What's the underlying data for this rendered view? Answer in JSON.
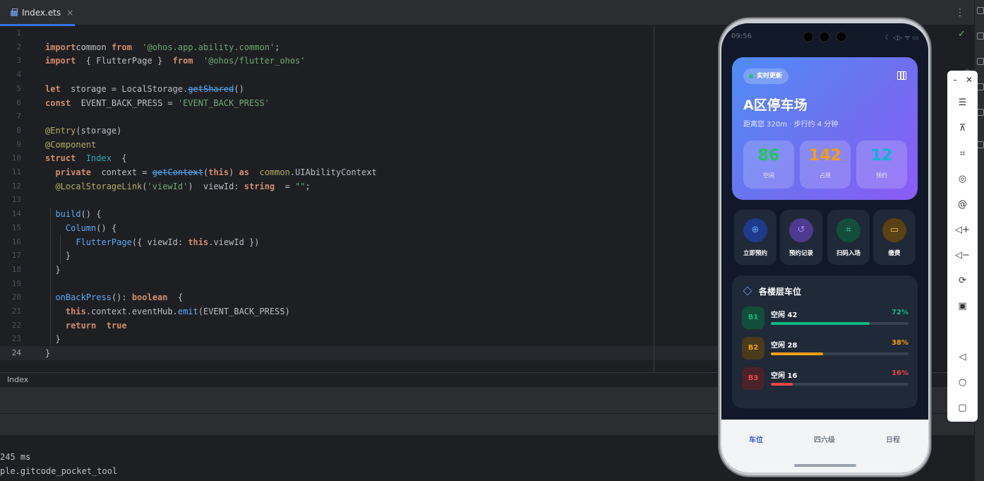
{
  "editor_tab": {
    "filename": "Index.ets",
    "close": "×"
  },
  "toolbar": {
    "more": "⋮",
    "check": "✓"
  },
  "code": {
    "line_numbers": [
      "1",
      "2",
      "3",
      "4",
      "5",
      "6",
      "7",
      "8",
      "9",
      "10",
      "11",
      "12",
      "13",
      "14",
      "15",
      "16",
      "17",
      "18",
      "19",
      "20",
      "21",
      "22",
      "23",
      "24"
    ],
    "lines": [
      [],
      [
        [
          "kw",
          "import"
        ],
        [
          "",
          "common "
        ],
        [
          "kw",
          "from"
        ],
        [
          "",
          "  "
        ],
        [
          "str",
          "'@ohos.app.ability.common'"
        ],
        [
          "",
          ";"
        ]
      ],
      [
        [
          "kw",
          "import"
        ],
        [
          "",
          "  { FlutterPage }  "
        ],
        [
          "kw",
          "from"
        ],
        [
          "",
          "  "
        ],
        [
          "str",
          "'@ohos/flutter_ohos'"
        ]
      ],
      [],
      [
        [
          "kw",
          "let"
        ],
        [
          "",
          "  storage = LocalStorage."
        ],
        [
          "st",
          "getShared"
        ],
        [
          "",
          "()"
        ]
      ],
      [
        [
          "kw",
          "const"
        ],
        [
          "",
          "  EVENT_BACK_PRESS = "
        ],
        [
          "str",
          "'EVENT_BACK_PRESS'"
        ]
      ],
      [],
      [
        [
          "ann",
          "@Entry"
        ],
        [
          "",
          "(storage)"
        ]
      ],
      [
        [
          "ann",
          "@Component"
        ]
      ],
      [
        [
          "kw",
          "struct"
        ],
        [
          "",
          "  "
        ],
        [
          "ty",
          "Index"
        ],
        [
          "",
          "  {"
        ]
      ],
      [
        [
          "",
          "  "
        ],
        [
          "kw",
          "private"
        ],
        [
          "",
          "  context = "
        ],
        [
          "st",
          "getContext"
        ],
        [
          "",
          "("
        ],
        [
          "kw",
          "this"
        ],
        [
          "",
          ") "
        ],
        [
          "kw",
          "as"
        ],
        [
          "",
          "  "
        ],
        [
          "ann",
          "common"
        ],
        [
          "",
          ".UIAbilityContext"
        ]
      ],
      [
        [
          "",
          "  "
        ],
        [
          "ann",
          "@LocalStorageLink"
        ],
        [
          "",
          "("
        ],
        [
          "str",
          "'viewId'"
        ],
        [
          "",
          ")  viewId: "
        ],
        [
          "kw",
          "string"
        ],
        [
          "",
          "  = "
        ],
        [
          "str",
          "\"\""
        ],
        [
          "",
          ";"
        ]
      ],
      [],
      [
        [
          "",
          "  "
        ],
        [
          "fn",
          "build"
        ],
        [
          "",
          "() {"
        ]
      ],
      [
        [
          "",
          "    "
        ],
        [
          "fn",
          "Column"
        ],
        [
          "",
          "() {"
        ]
      ],
      [
        [
          "",
          "      "
        ],
        [
          "fn",
          "FlutterPage"
        ],
        [
          "",
          "({ viewId: "
        ],
        [
          "kw",
          "this"
        ],
        [
          "",
          ".viewId })"
        ]
      ],
      [
        [
          "",
          "    }"
        ]
      ],
      [
        [
          "",
          "  }"
        ]
      ],
      [],
      [
        [
          "",
          "  "
        ],
        [
          "fn",
          "onBackPress"
        ],
        [
          "",
          "(): "
        ],
        [
          "kw",
          "boolean"
        ],
        [
          "",
          "  {"
        ]
      ],
      [
        [
          "",
          "    "
        ],
        [
          "kw",
          "this"
        ],
        [
          "",
          ".context.eventHub."
        ],
        [
          "fn",
          "emit"
        ],
        [
          "",
          "(EVENT_BACK_PRESS)"
        ]
      ],
      [
        [
          "",
          "    "
        ],
        [
          "kw",
          "return"
        ],
        [
          "",
          "  "
        ],
        [
          "kw",
          "true"
        ]
      ],
      [
        [
          "",
          "  }"
        ]
      ],
      [
        [
          "",
          "}"
        ]
      ]
    ]
  },
  "breadcrumb": "Index",
  "console": {
    "line1": "245 ms",
    "line2": "ple.gitcode_pocket_tool"
  },
  "phone": {
    "status_time": "09:56",
    "status_right": "☾ ◁▷ ᯤ ▭",
    "hero": {
      "badge": "实时更新",
      "title": "A区停车场",
      "subtitle": "距离您 320m · 步行约 4 分钟",
      "stats": [
        {
          "value": "86",
          "label": "空闲",
          "color": "#22c55e"
        },
        {
          "value": "142",
          "label": "占用",
          "color": "#f59e0b"
        },
        {
          "value": "12",
          "label": "预约",
          "color": "#06b6d4"
        }
      ]
    },
    "actions": [
      {
        "label": "立即预约",
        "icon": "⊕",
        "bg": "#1e3a8a",
        "fg": "#60a5fa"
      },
      {
        "label": "预约记录",
        "icon": "↺",
        "bg": "#4c3b8f",
        "fg": "#a78bfa"
      },
      {
        "label": "扫码入场",
        "icon": "⌗",
        "bg": "#134e3a",
        "fg": "#34d399"
      },
      {
        "label": "缴费",
        "icon": "▭",
        "bg": "#5a4214",
        "fg": "#fbbf24"
      }
    ],
    "floors": {
      "title": "各楼层车位",
      "rows": [
        {
          "floor": "B1",
          "label": "空闲 42",
          "pct": "72%",
          "fill": 0.72,
          "color": "#10b981",
          "bg": "#134e3a"
        },
        {
          "floor": "B2",
          "label": "空闲 28",
          "pct": "38%",
          "fill": 0.38,
          "color": "#f59e0b",
          "bg": "#4a3b1a"
        },
        {
          "floor": "B3",
          "label": "空闲 16",
          "pct": "16%",
          "fill": 0.16,
          "color": "#ef4444",
          "bg": "#4a2329"
        }
      ]
    },
    "nav": [
      {
        "label": "车位",
        "active": true
      },
      {
        "label": "四六级",
        "active": false
      },
      {
        "label": "日程",
        "active": false
      }
    ]
  },
  "emulator_tools": {
    "minimize": "–",
    "close": "✕",
    "items": [
      "☰",
      "⊼",
      "⌗",
      "◎",
      "@",
      "◁+",
      "◁−",
      "⟳",
      "▣",
      "◁",
      "○",
      "▢"
    ]
  }
}
